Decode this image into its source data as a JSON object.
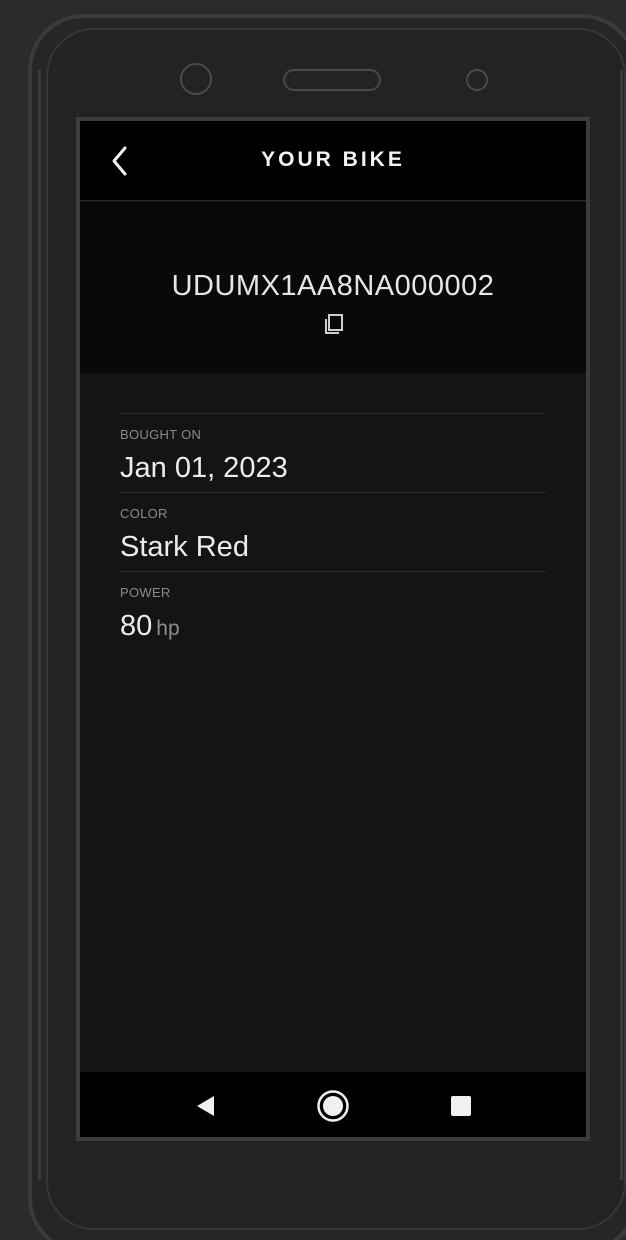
{
  "header": {
    "title": "YOUR BIKE",
    "back_icon": "chevron-left-icon"
  },
  "vin": {
    "value": "UDUMX1AA8NA000002",
    "copy_icon": "copy-icon"
  },
  "details": [
    {
      "label": "BOUGHT ON",
      "value": "Jan 01, 2023",
      "unit": ""
    },
    {
      "label": "COLOR",
      "value": "Stark Red",
      "unit": ""
    },
    {
      "label": "POWER",
      "value": "80",
      "unit": "hp"
    }
  ],
  "nav": {
    "back_icon": "triangle-back-icon",
    "home_icon": "home-circle-icon",
    "recents_icon": "square-recents-icon"
  },
  "colors": {
    "frame_bg": "#2b2b2b",
    "screen_bg": "#141414",
    "header_bg": "#000000",
    "text_primary": "#ececec",
    "text_muted": "#8a8a8a"
  }
}
